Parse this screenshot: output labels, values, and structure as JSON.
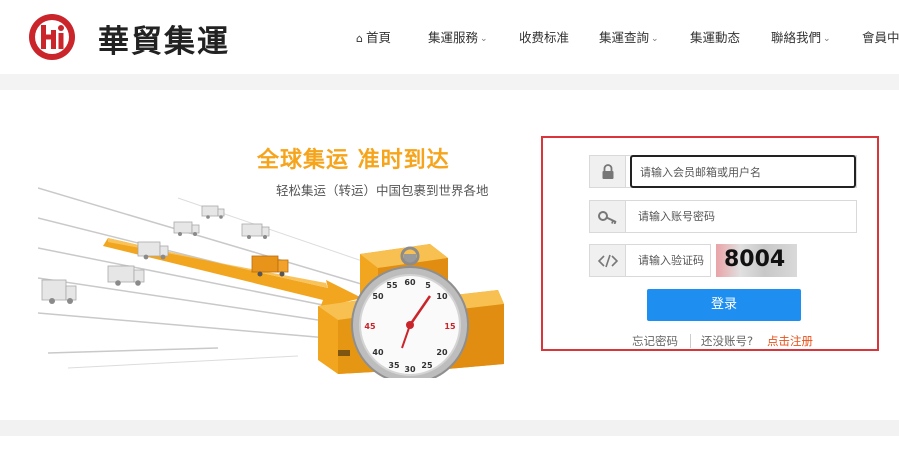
{
  "header": {
    "brand": "華貿集運",
    "nav": [
      {
        "label": "首頁",
        "icon": "home-icon",
        "dropdown": false
      },
      {
        "label": "集運服務",
        "dropdown": true
      },
      {
        "label": "收费标准",
        "dropdown": false
      },
      {
        "label": "集運查詢",
        "dropdown": true
      },
      {
        "label": "集運動态",
        "dropdown": false
      },
      {
        "label": "聯絡我們",
        "dropdown": true
      },
      {
        "label": "會員中心",
        "dropdown": false
      }
    ]
  },
  "hero": {
    "slogan": "全球集运  准时到达",
    "sub_slogan": "轻松集运（转运）中国包裹到世界各地",
    "stopwatch_numbers": [
      "55",
      "60",
      "5",
      "50",
      "10",
      "45",
      "15",
      "40",
      "20",
      "35",
      "30",
      "25"
    ]
  },
  "login": {
    "username_placeholder": "请输入会员邮箱或用户名",
    "password_placeholder": "请输入账号密码",
    "captcha_placeholder": "请输入验证码",
    "captcha_code": "8004",
    "submit_label": "登录",
    "forgot_label": "忘记密码",
    "no_account_label": "还没账号?",
    "register_label": "点击注册"
  },
  "colors": {
    "accent": "#1e8ff0",
    "highlight_border": "#d9363c",
    "slogan": "#f5a41c",
    "register_link": "#e8531b",
    "logo_red": "#c9252b"
  }
}
